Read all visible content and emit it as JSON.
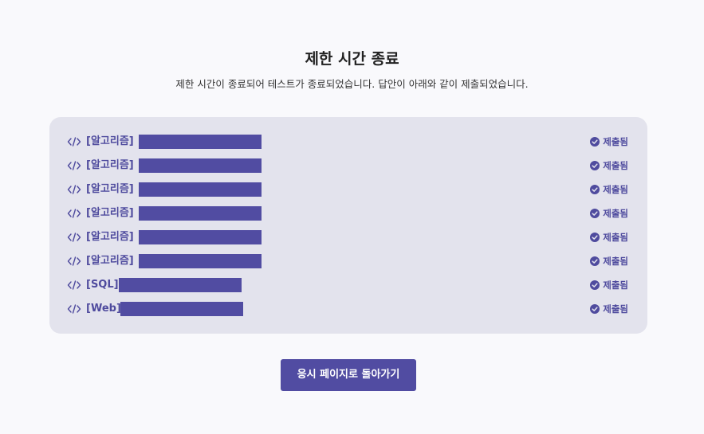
{
  "header": {
    "title": "제한 시간 종료",
    "subtitle": "제한 시간이 종료되어 테스트가 종료되었습니다. 답안이 아래와 같이 제출되었습니다."
  },
  "colors": {
    "accent": "#514ca2",
    "panel": "#e3e3ed",
    "background": "#f9f9fc"
  },
  "submissions": [
    {
      "label": "[알고리즘]",
      "status": "제출됨",
      "icon": "code-icon",
      "status_icon": "check-circle-icon"
    },
    {
      "label": "[알고리즘]",
      "status": "제출됨",
      "icon": "code-icon",
      "status_icon": "check-circle-icon"
    },
    {
      "label": "[알고리즘]",
      "status": "제출됨",
      "icon": "code-icon",
      "status_icon": "check-circle-icon"
    },
    {
      "label": "[알고리즘]",
      "status": "제출됨",
      "icon": "code-icon",
      "status_icon": "check-circle-icon"
    },
    {
      "label": "[알고리즘]",
      "status": "제출됨",
      "icon": "code-icon",
      "status_icon": "check-circle-icon"
    },
    {
      "label": "[알고리즘]",
      "status": "제출됨",
      "icon": "code-icon",
      "status_icon": "check-circle-icon"
    },
    {
      "label": "[SQL]",
      "status": "제출됨",
      "icon": "code-icon",
      "status_icon": "check-circle-icon"
    },
    {
      "label": "[Web]",
      "status": "제출됨",
      "icon": "code-icon",
      "status_icon": "check-circle-icon"
    }
  ],
  "actions": {
    "back_label": "응시 페이지로 돌아가기"
  }
}
